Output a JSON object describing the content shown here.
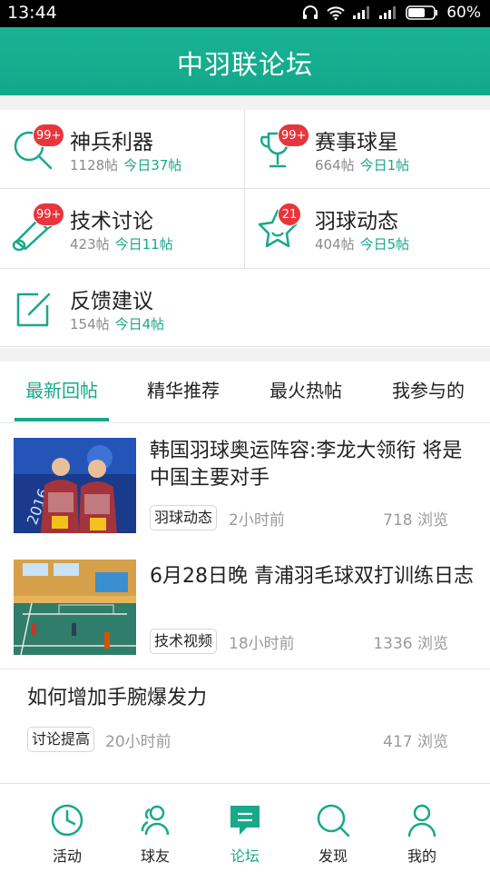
{
  "status_bar": {
    "time": "13:44",
    "battery": "60%"
  },
  "header": {
    "title": "中羽联论坛"
  },
  "forums": [
    {
      "name": "神兵利器",
      "posts": "1128帖",
      "today": "今日37帖",
      "badge": "99+",
      "icon": "magnifier-icon"
    },
    {
      "name": "赛事球星",
      "posts": "664帖",
      "today": "今日1帖",
      "badge": "99+",
      "icon": "trophy-icon"
    },
    {
      "name": "技术讨论",
      "posts": "423帖",
      "today": "今日11帖",
      "badge": "99+",
      "icon": "shuttlecock-icon"
    },
    {
      "name": "羽球动态",
      "posts": "404帖",
      "today": "今日5帖",
      "badge": "21",
      "icon": "star-icon"
    },
    {
      "name": "反馈建议",
      "posts": "154帖",
      "today": "今日4帖",
      "badge": "",
      "icon": "edit-icon"
    }
  ],
  "tabs": [
    "最新回帖",
    "精华推荐",
    "最火热帖",
    "我参与的"
  ],
  "active_tab": 0,
  "posts": [
    {
      "title": "韩国羽球奥运阵容:李龙大领衔 将是中国主要对手",
      "tag": "羽球动态",
      "time": "2小时前",
      "views": "718 浏览",
      "thumb": "players-photo"
    },
    {
      "title": "6月28日晚 青浦羽毛球双打训练日志",
      "tag": "技术视频",
      "time": "18小时前",
      "views": "1336 浏览",
      "thumb": "court-photo"
    },
    {
      "title": "如何增加手腕爆发力",
      "tag": "讨论提高",
      "time": "20小时前",
      "views": "417 浏览"
    }
  ],
  "bottom_nav": [
    {
      "label": "活动",
      "icon": "clock-icon"
    },
    {
      "label": "球友",
      "icon": "friends-icon"
    },
    {
      "label": "论坛",
      "icon": "forum-chat-icon"
    },
    {
      "label": "发现",
      "icon": "search-icon"
    },
    {
      "label": "我的",
      "icon": "profile-icon"
    }
  ],
  "active_nav": 2,
  "colors": {
    "accent": "#18a88a",
    "header": "#15ad8f",
    "badge": "#e8353b"
  }
}
